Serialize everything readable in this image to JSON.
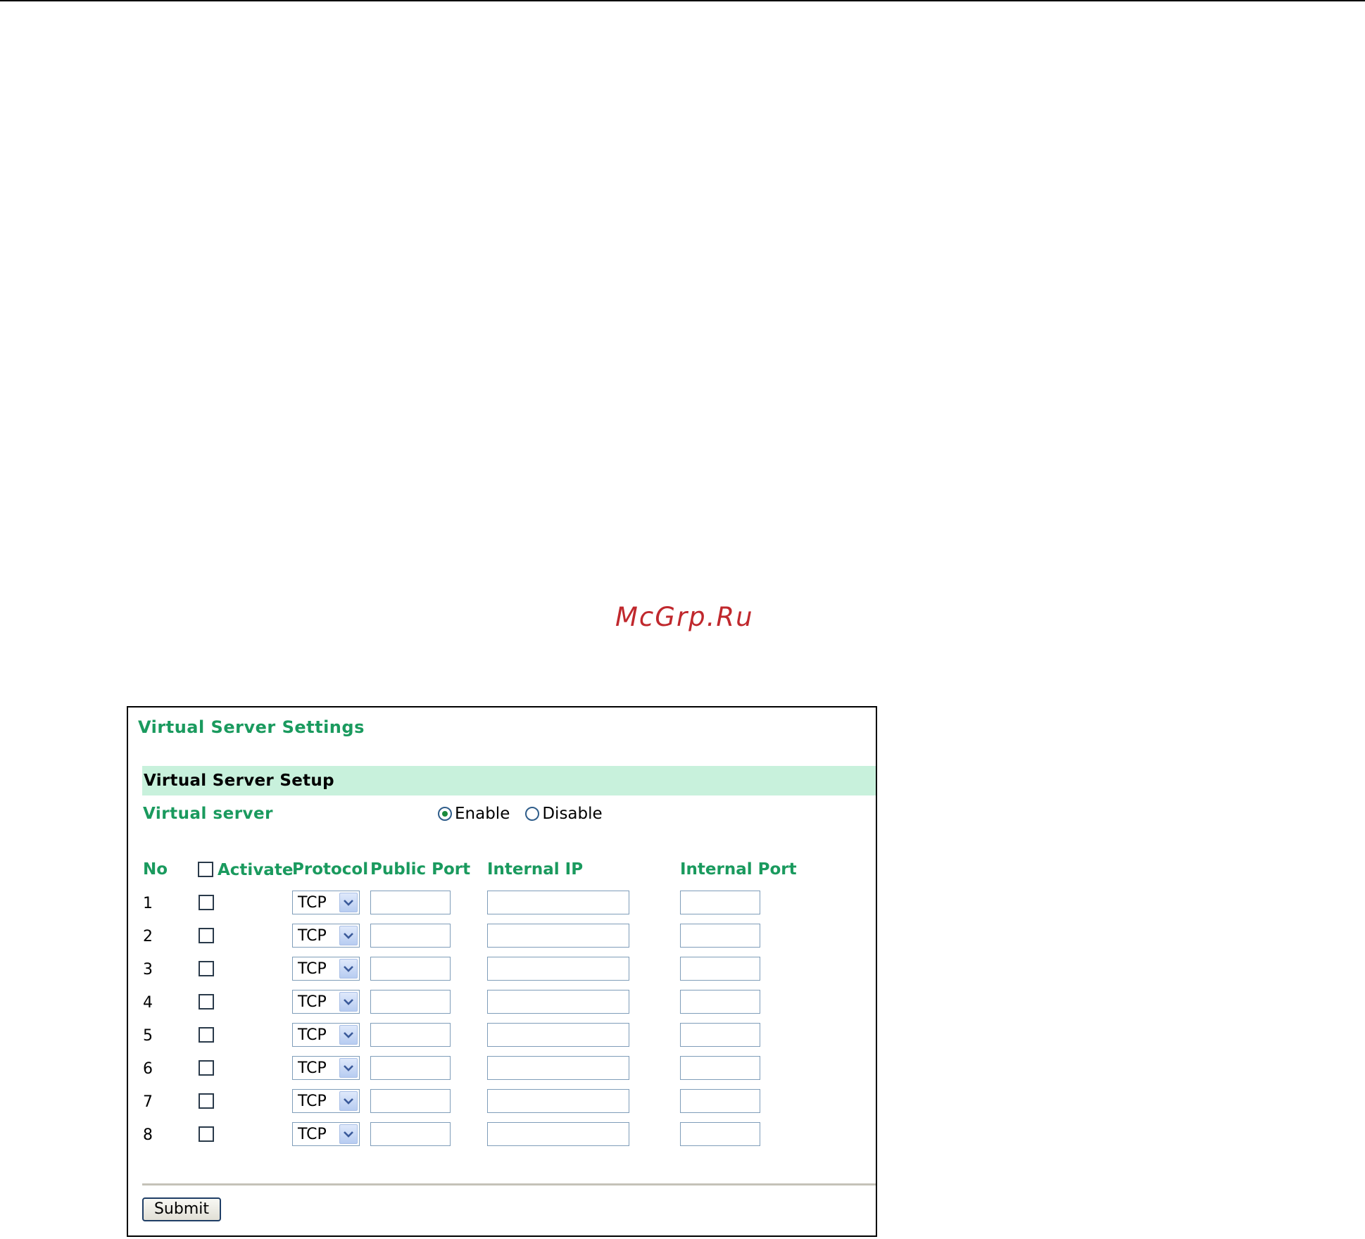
{
  "watermark": "McGrp.Ru",
  "panel": {
    "title": "Virtual Server Settings",
    "setup_title": "Virtual Server Setup",
    "virtual_server_label": "Virtual server",
    "radio_enable": "Enable",
    "radio_disable": "Disable",
    "selected_mode": "Enable"
  },
  "table": {
    "headers": {
      "no": "No",
      "activate": "Activate",
      "protocol": "Protocol",
      "public_port": "Public Port",
      "internal_ip": "Internal IP",
      "internal_port": "Internal Port"
    },
    "rows": [
      {
        "no": "1",
        "activate": false,
        "protocol": "TCP",
        "public_port": "",
        "internal_ip": "",
        "internal_port": ""
      },
      {
        "no": "2",
        "activate": false,
        "protocol": "TCP",
        "public_port": "",
        "internal_ip": "",
        "internal_port": ""
      },
      {
        "no": "3",
        "activate": false,
        "protocol": "TCP",
        "public_port": "",
        "internal_ip": "",
        "internal_port": ""
      },
      {
        "no": "4",
        "activate": false,
        "protocol": "TCP",
        "public_port": "",
        "internal_ip": "",
        "internal_port": ""
      },
      {
        "no": "5",
        "activate": false,
        "protocol": "TCP",
        "public_port": "",
        "internal_ip": "",
        "internal_port": ""
      },
      {
        "no": "6",
        "activate": false,
        "protocol": "TCP",
        "public_port": "",
        "internal_ip": "",
        "internal_port": ""
      },
      {
        "no": "7",
        "activate": false,
        "protocol": "TCP",
        "public_port": "",
        "internal_ip": "",
        "internal_port": ""
      },
      {
        "no": "8",
        "activate": false,
        "protocol": "TCP",
        "public_port": "",
        "internal_ip": "",
        "internal_port": ""
      }
    ]
  },
  "submit_label": "Submit",
  "colors": {
    "heading_green": "#1a9a5e",
    "setup_bar_bg": "#c8f1dc",
    "watermark_red": "#c0282d"
  }
}
